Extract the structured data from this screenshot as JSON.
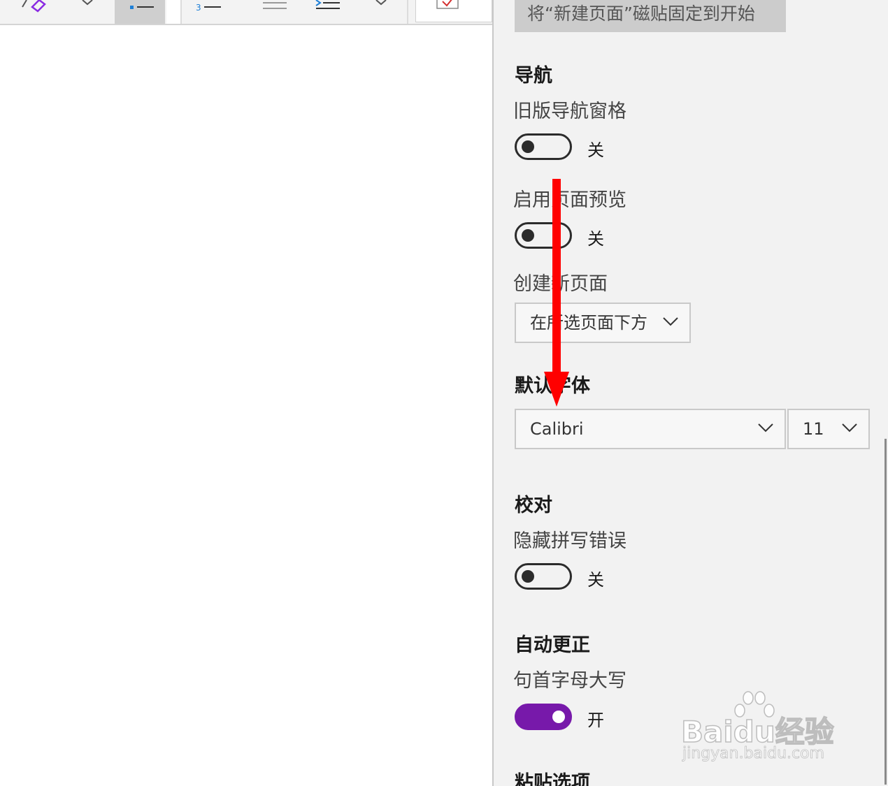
{
  "banner": {
    "pin_button": "将“新建页面”磁贴固定到开始"
  },
  "navigation": {
    "title": "导航",
    "legacy_pane": {
      "label": "旧版导航窗格",
      "state": "关"
    },
    "page_preview": {
      "label": "启用页面预览",
      "state": "关"
    },
    "new_page": {
      "label": "创建新页面",
      "value": "在所选页面下方"
    }
  },
  "default_font": {
    "title": "默认字体",
    "family": "Calibri",
    "size": "11"
  },
  "proofing": {
    "title": "校对",
    "hide_spelling": {
      "label": "隐藏拼写错误",
      "state": "关"
    }
  },
  "autocorrect": {
    "title": "自动更正",
    "capitalize": {
      "label": "句首字母大写",
      "state": "开"
    }
  },
  "paste": {
    "title": "粘贴选项"
  },
  "watermark": {
    "text": "Baidu经验",
    "url": "jingyan.baidu.com"
  },
  "colors": {
    "accent": "#7719aa",
    "arrow": "#ff0000"
  }
}
